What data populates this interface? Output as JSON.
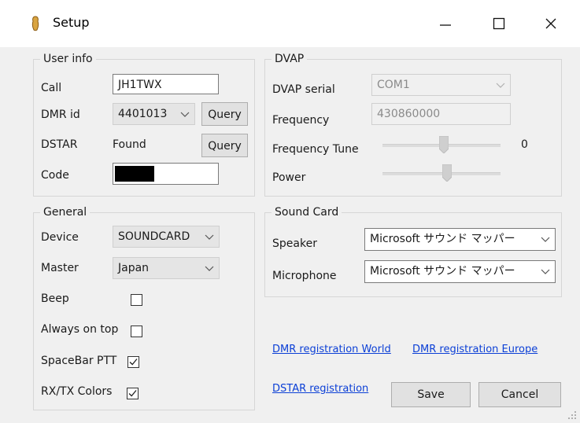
{
  "window": {
    "title": "Setup",
    "controls": {
      "minimize": "minimize-icon",
      "maximize": "maximize-icon",
      "close": "close-icon"
    }
  },
  "user_info": {
    "title": "User info",
    "call_label": "Call",
    "call_value": "JH1TWX",
    "dmr_label": "DMR id",
    "dmr_value": "4401013",
    "query_label": "Query",
    "dstar_label": "DSTAR",
    "dstar_status": "Found",
    "code_label": "Code"
  },
  "dvap": {
    "title": "DVAP",
    "serial_label": "DVAP serial",
    "serial_value": "COM1",
    "frequency_label": "Frequency",
    "frequency_value": "430860000",
    "tune_label": "Frequency Tune",
    "tune_value": "0",
    "tune_level": 0.52,
    "power_label": "Power",
    "power_level": 0.55
  },
  "general": {
    "title": "General",
    "device_label": "Device",
    "device_value": "SOUNDCARD",
    "master_label": "Master",
    "master_value": "Japan",
    "beep_label": "Beep",
    "beep_checked": false,
    "always_on_top_label": "Always on top",
    "always_on_top_checked": false,
    "spacebar_ptt_label": "SpaceBar PTT",
    "spacebar_ptt_checked": true,
    "rxtx_colors_label": "RX/TX Colors",
    "rxtx_colors_checked": true
  },
  "sound_card": {
    "title": "Sound Card",
    "speaker_label": "Speaker",
    "speaker_value": "Microsoft サウンド マッパー",
    "microphone_label": "Microphone",
    "microphone_value": "Microsoft サウンド マッパー"
  },
  "links": {
    "dmr_world": "DMR registration World",
    "dmr_europe": "DMR registration Europe",
    "dstar": "DSTAR registration"
  },
  "buttons": {
    "save": "Save",
    "cancel": "Cancel"
  },
  "colors": {
    "link": "#0b3fd6",
    "window_bg": "#f0f0f0",
    "title_bg": "#ffffff"
  }
}
